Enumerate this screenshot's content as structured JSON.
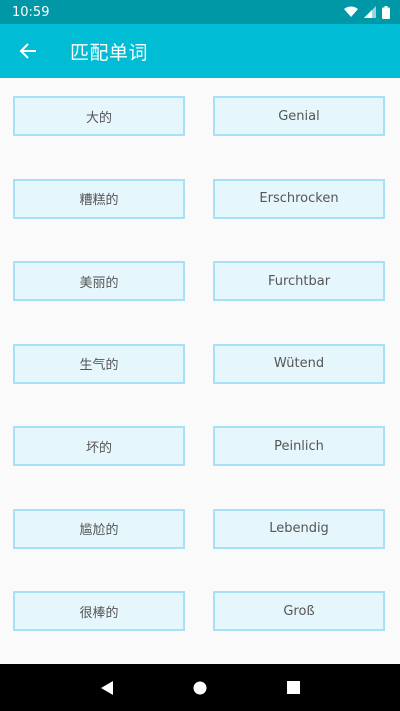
{
  "status": {
    "time": "10:59"
  },
  "appbar": {
    "title": "匹配单词",
    "back_icon": "arrow-left-icon"
  },
  "pairs": [
    {
      "left": "大的",
      "right": "Genial"
    },
    {
      "left": "糟糕的",
      "right": "Erschrocken"
    },
    {
      "left": "美丽的",
      "right": "Furchtbar"
    },
    {
      "left": "生气的",
      "right": "Wütend"
    },
    {
      "left": "坏的",
      "right": "Peinlich"
    },
    {
      "left": "尴尬的",
      "right": "Lebendig"
    },
    {
      "left": "很棒的",
      "right": "Groß"
    }
  ],
  "colors": {
    "status_bar": "#0097a7",
    "app_bar": "#00bcd4",
    "card_bg": "#e6f6fd",
    "card_border": "#a7e1f7"
  }
}
